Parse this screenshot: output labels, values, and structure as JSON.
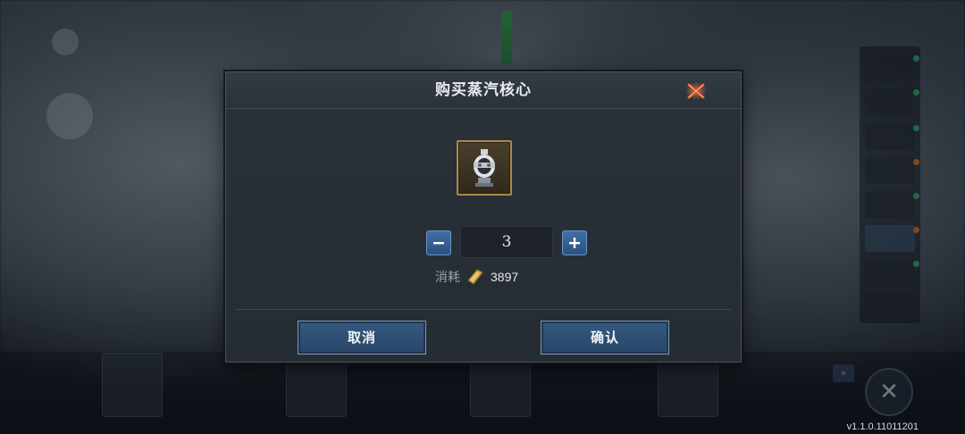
{
  "dialog": {
    "title": "购买蒸汽核心",
    "quantity": "3",
    "cost_label": "消耗",
    "cost_value": "3897",
    "cancel_label": "取消",
    "confirm_label": "确认"
  },
  "footer": {
    "version": "v1.1.0.11011201"
  },
  "colors": {
    "accent_button": "#2f5176",
    "close_icon": "#d8532a",
    "gold_item_frame": "#a88a4c"
  }
}
